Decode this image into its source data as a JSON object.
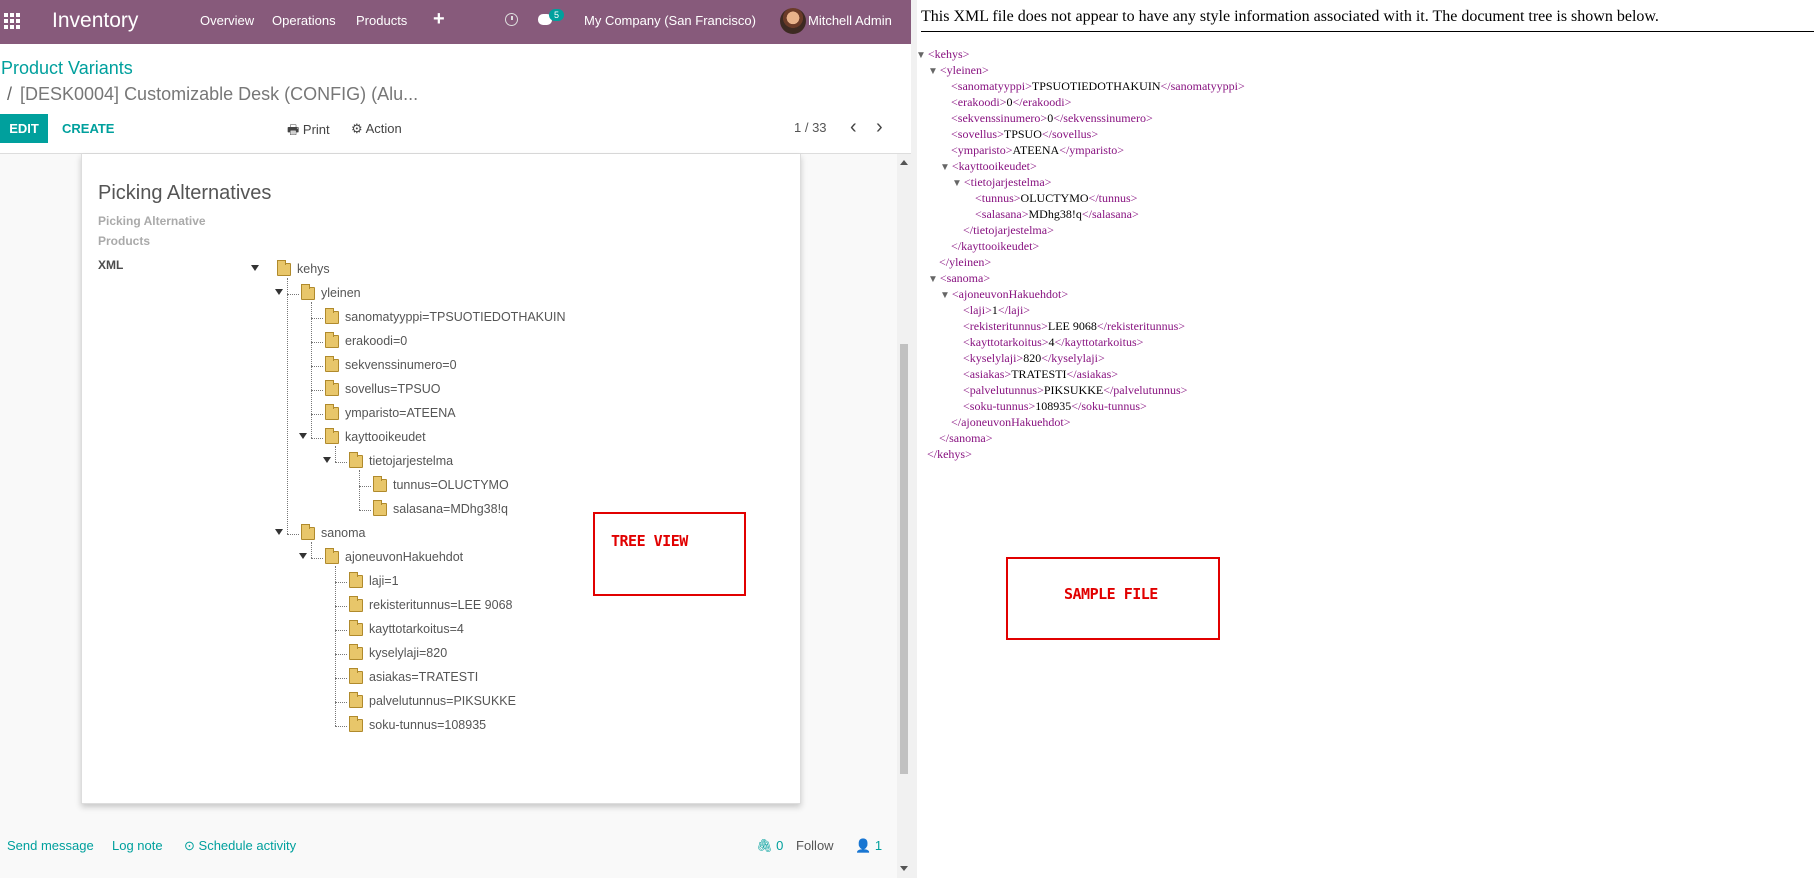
{
  "navbar": {
    "brand": "Inventory",
    "menu": [
      "Overview",
      "Operations",
      "Products"
    ],
    "plus": "+",
    "chat_count": "5",
    "company": "My Company (San Francisco)",
    "user": "Mitchell Admin"
  },
  "breadcrumb": {
    "parent": "Product Variants",
    "separator": "/",
    "current": "[DESK0004] Customizable Desk (CONFIG) (Alu..."
  },
  "buttons": {
    "edit": "EDIT",
    "create": "CREATE",
    "print": "Print",
    "action": "Action"
  },
  "pager": {
    "value": "1 / 33",
    "prev": "‹",
    "next": "›"
  },
  "sheet": {
    "title": "Picking Alternatives",
    "label_picking": "Picking Alternative",
    "label_products": "Products",
    "label_xml": "XML"
  },
  "tree": [
    {
      "label": "kehys",
      "level": 0,
      "toggle": true
    },
    {
      "label": "yleinen",
      "level": 1,
      "toggle": true
    },
    {
      "label": "sanomatyyppi=TPSUOTIEDOTHAKUIN",
      "level": 2,
      "toggle": false
    },
    {
      "label": "erakoodi=0",
      "level": 2,
      "toggle": false
    },
    {
      "label": "sekvenssinumero=0",
      "level": 2,
      "toggle": false
    },
    {
      "label": "sovellus=TPSUO",
      "level": 2,
      "toggle": false
    },
    {
      "label": "ymparisto=ATEENA",
      "level": 2,
      "toggle": false
    },
    {
      "label": "kayttooikeudet",
      "level": 2,
      "toggle": true
    },
    {
      "label": "tietojarjestelma",
      "level": 3,
      "toggle": true
    },
    {
      "label": "tunnus=OLUCTYMO",
      "level": 4,
      "toggle": false
    },
    {
      "label": "salasana=MDhg38!q",
      "level": 4,
      "toggle": false
    },
    {
      "label": "sanoma",
      "level": 1,
      "toggle": true
    },
    {
      "label": "ajoneuvonHakuehdot",
      "level": 2,
      "toggle": true
    },
    {
      "label": "laji=1",
      "level": 3,
      "toggle": false
    },
    {
      "label": "rekisteritunnus=LEE 9068",
      "level": 3,
      "toggle": false
    },
    {
      "label": "kayttotarkoitus=4",
      "level": 3,
      "toggle": false
    },
    {
      "label": "kyselylaji=820",
      "level": 3,
      "toggle": false
    },
    {
      "label": "asiakas=TRATESTI",
      "level": 3,
      "toggle": false
    },
    {
      "label": "palvelutunnus=PIKSUKKE",
      "level": 3,
      "toggle": false
    },
    {
      "label": "soku-tunnus=108935",
      "level": 3,
      "toggle": false
    }
  ],
  "annotations": {
    "tree_view": "TREE VIEW",
    "sample_file": "SAMPLE FILE"
  },
  "chatter": {
    "send_message": "Send message",
    "log_note": "Log note",
    "schedule_activity": "Schedule activity",
    "attachments": "0",
    "follow": "Follow",
    "followers": "1"
  },
  "xml_viewer": {
    "notice": "This XML file does not appear to have any style information associated with it. The document tree is shown below.",
    "lines": [
      {
        "indent": 0,
        "arrow": true,
        "open": "<kehys>",
        "text": "",
        "close": ""
      },
      {
        "indent": 1,
        "arrow": true,
        "open": "<yleinen>",
        "text": "",
        "close": ""
      },
      {
        "indent": 2,
        "arrow": false,
        "open": "<sanomatyyppi>",
        "text": "TPSUOTIEDOTHAKUIN",
        "close": "</sanomatyyppi>"
      },
      {
        "indent": 2,
        "arrow": false,
        "open": "<erakoodi>",
        "text": "0",
        "close": "</erakoodi>"
      },
      {
        "indent": 2,
        "arrow": false,
        "open": "<sekvenssinumero>",
        "text": "0",
        "close": "</sekvenssinumero>"
      },
      {
        "indent": 2,
        "arrow": false,
        "open": "<sovellus>",
        "text": "TPSUO",
        "close": "</sovellus>"
      },
      {
        "indent": 2,
        "arrow": false,
        "open": "<ymparisto>",
        "text": "ATEENA",
        "close": "</ymparisto>"
      },
      {
        "indent": 2,
        "arrow": true,
        "open": "<kayttooikeudet>",
        "text": "",
        "close": ""
      },
      {
        "indent": 3,
        "arrow": true,
        "open": "<tietojarjestelma>",
        "text": "",
        "close": ""
      },
      {
        "indent": 4,
        "arrow": false,
        "open": "<tunnus>",
        "text": "OLUCTYMO",
        "close": "</tunnus>"
      },
      {
        "indent": 4,
        "arrow": false,
        "open": "<salasana>",
        "text": "MDhg38!q",
        "close": "</salasana>"
      },
      {
        "indent": 3,
        "arrow": false,
        "open": "</tietojarjestelma>",
        "text": "",
        "close": ""
      },
      {
        "indent": 2,
        "arrow": false,
        "open": "</kayttooikeudet>",
        "text": "",
        "close": ""
      },
      {
        "indent": 1,
        "arrow": false,
        "open": "</yleinen>",
        "text": "",
        "close": ""
      },
      {
        "indent": 1,
        "arrow": true,
        "open": "<sanoma>",
        "text": "",
        "close": ""
      },
      {
        "indent": 2,
        "arrow": true,
        "open": "<ajoneuvonHakuehdot>",
        "text": "",
        "close": ""
      },
      {
        "indent": 3,
        "arrow": false,
        "open": "<laji>",
        "text": "1",
        "close": "</laji>"
      },
      {
        "indent": 3,
        "arrow": false,
        "open": "<rekisteritunnus>",
        "text": "LEE 9068",
        "close": "</rekisteritunnus>"
      },
      {
        "indent": 3,
        "arrow": false,
        "open": "<kayttotarkoitus>",
        "text": "4",
        "close": "</kayttotarkoitus>"
      },
      {
        "indent": 3,
        "arrow": false,
        "open": "<kyselylaji>",
        "text": "820",
        "close": "</kyselylaji>"
      },
      {
        "indent": 3,
        "arrow": false,
        "open": "<asiakas>",
        "text": "TRATESTI",
        "close": "</asiakas>"
      },
      {
        "indent": 3,
        "arrow": false,
        "open": "<palvelutunnus>",
        "text": "PIKSUKKE",
        "close": "</palvelutunnus>"
      },
      {
        "indent": 3,
        "arrow": false,
        "open": "<soku-tunnus>",
        "text": "108935",
        "close": "</soku-tunnus>"
      },
      {
        "indent": 2,
        "arrow": false,
        "open": "</ajoneuvonHakuehdot>",
        "text": "",
        "close": ""
      },
      {
        "indent": 1,
        "arrow": false,
        "open": "</sanoma>",
        "text": "",
        "close": ""
      },
      {
        "indent": 0,
        "arrow": false,
        "open": "</kehys>",
        "text": "",
        "close": ""
      }
    ]
  },
  "colors": {
    "navbar": "#875a7b",
    "accent": "#00a09d",
    "xml_tag": "#881280",
    "annotation": "#e10000"
  }
}
